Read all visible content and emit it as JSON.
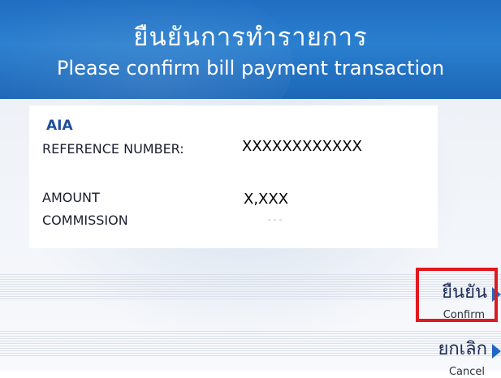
{
  "header": {
    "title_th": "ยืนยันการทำรายการ",
    "title_en": "Please confirm bill payment transaction"
  },
  "details": {
    "payee": "AIA",
    "reference_label": "REFERENCE NUMBER:",
    "reference_value": "XXXXXXXXXXXX",
    "amount_label": "AMOUNT",
    "amount_value": "X,XXX",
    "commission_label": "COMMISSION",
    "commission_value": "- - -"
  },
  "buttons": {
    "confirm_th": "ยืนยัน",
    "confirm_en": "Confirm",
    "cancel_th": "ยกเลิก",
    "cancel_en": "Cancel"
  },
  "colors": {
    "header_blue": "#2b7fcf",
    "highlight_red": "#e0191f",
    "arrow_blue": "#1f66c4"
  },
  "icons": [
    "confirm-arrow-icon",
    "cancel-arrow-icon"
  ]
}
